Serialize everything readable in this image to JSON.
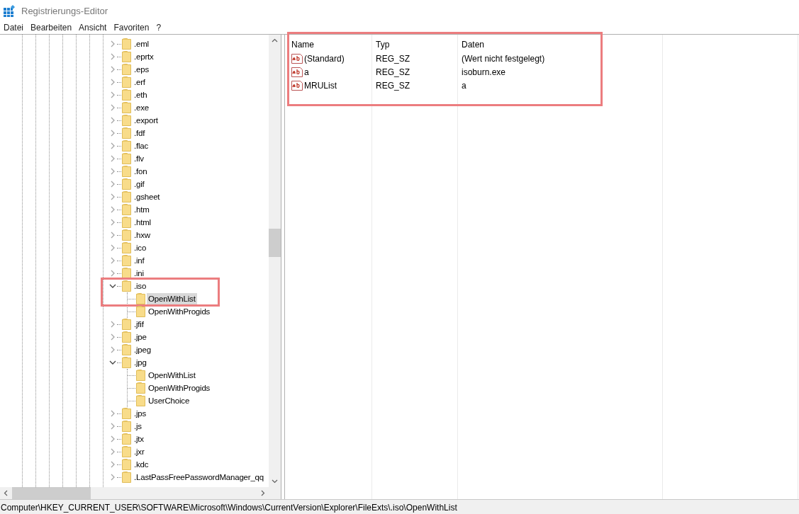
{
  "window": {
    "title": "Registrierungs-Editor"
  },
  "menu": [
    "Datei",
    "Bearbeiten",
    "Ansicht",
    "Favoriten",
    "?"
  ],
  "tree": [
    {
      "label": ".eml",
      "expanded": false,
      "selected": false
    },
    {
      "label": ".eprtx",
      "expanded": false,
      "selected": false
    },
    {
      "label": ".eps",
      "expanded": false,
      "selected": false
    },
    {
      "label": ".erf",
      "expanded": false,
      "selected": false
    },
    {
      "label": ".eth",
      "expanded": false,
      "selected": false
    },
    {
      "label": ".exe",
      "expanded": false,
      "selected": false
    },
    {
      "label": ".export",
      "expanded": false,
      "selected": false
    },
    {
      "label": ".fdf",
      "expanded": false,
      "selected": false
    },
    {
      "label": ".flac",
      "expanded": false,
      "selected": false
    },
    {
      "label": ".flv",
      "expanded": false,
      "selected": false
    },
    {
      "label": ".fon",
      "expanded": false,
      "selected": false
    },
    {
      "label": ".gif",
      "expanded": false,
      "selected": false
    },
    {
      "label": ".gsheet",
      "expanded": false,
      "selected": false
    },
    {
      "label": ".htm",
      "expanded": false,
      "selected": false
    },
    {
      "label": ".html",
      "expanded": false,
      "selected": false
    },
    {
      "label": ".hxw",
      "expanded": false,
      "selected": false
    },
    {
      "label": ".ico",
      "expanded": false,
      "selected": false
    },
    {
      "label": ".inf",
      "expanded": false,
      "selected": false
    },
    {
      "label": ".ini",
      "expanded": false,
      "selected": false
    },
    {
      "label": ".iso",
      "expanded": true,
      "selected": false,
      "children": [
        {
          "label": "OpenWithList",
          "selected": true,
          "highlighted": true
        },
        {
          "label": "OpenWithProgids",
          "selected": false,
          "highlighted": false
        }
      ]
    },
    {
      "label": ".jfif",
      "expanded": false,
      "selected": false
    },
    {
      "label": ".jpe",
      "expanded": false,
      "selected": false
    },
    {
      "label": ".jpeg",
      "expanded": false,
      "selected": false
    },
    {
      "label": ".jpg",
      "expanded": true,
      "selected": false,
      "children": [
        {
          "label": "OpenWithList",
          "selected": false,
          "highlighted": false
        },
        {
          "label": "OpenWithProgids",
          "selected": false,
          "highlighted": false
        },
        {
          "label": "UserChoice",
          "selected": false,
          "highlighted": false
        }
      ]
    },
    {
      "label": ".jps",
      "expanded": false,
      "selected": false
    },
    {
      "label": ".js",
      "expanded": false,
      "selected": false
    },
    {
      "label": ".jtx",
      "expanded": false,
      "selected": false
    },
    {
      "label": ".jxr",
      "expanded": false,
      "selected": false
    },
    {
      "label": ".kdc",
      "expanded": false,
      "selected": false
    },
    {
      "label": ".LastPassFreePasswordManager_qq",
      "expanded": false,
      "selected": false
    }
  ],
  "values": {
    "highlighted": true,
    "columns": [
      "Name",
      "Typ",
      "Daten"
    ],
    "rows": [
      {
        "name": "(Standard)",
        "type": "REG_SZ",
        "data": "(Wert nicht festgelegt)"
      },
      {
        "name": "a",
        "type": "REG_SZ",
        "data": "isoburn.exe"
      },
      {
        "name": "MRUList",
        "type": "REG_SZ",
        "data": "a"
      }
    ]
  },
  "status_bar": "Computer\\HKEY_CURRENT_USER\\SOFTWARE\\Microsoft\\Windows\\CurrentVersion\\Explorer\\FileExts\\.iso\\OpenWithList"
}
